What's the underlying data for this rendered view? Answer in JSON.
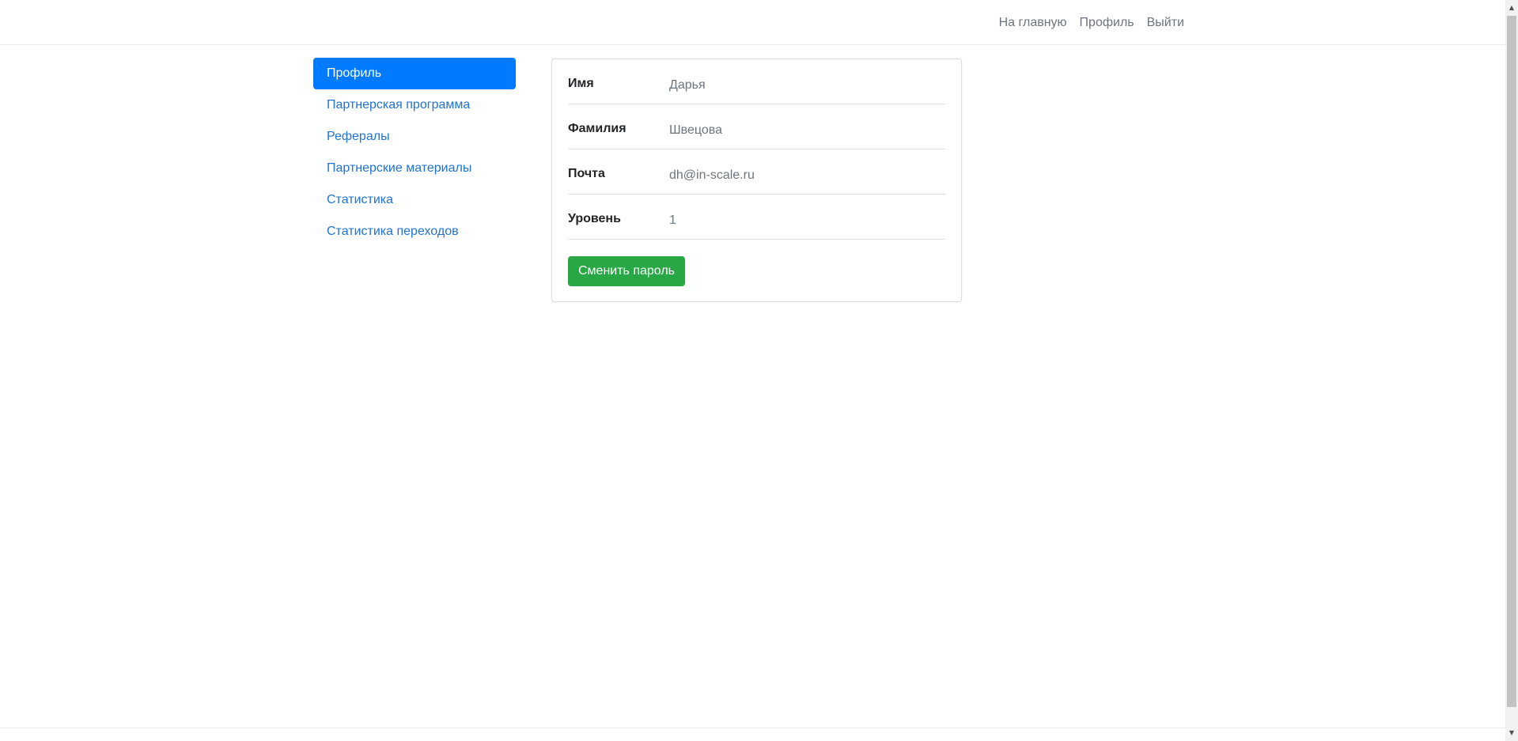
{
  "navbar": {
    "links": [
      "На главную",
      "Профиль",
      "Выйти"
    ]
  },
  "sidebar": {
    "items": [
      {
        "label": "Профиль",
        "active": true
      },
      {
        "label": "Партнерская программа",
        "active": false
      },
      {
        "label": "Рефералы",
        "active": false
      },
      {
        "label": "Партнерские материалы",
        "active": false
      },
      {
        "label": "Статистика",
        "active": false
      },
      {
        "label": "Статистика переходов",
        "active": false
      }
    ]
  },
  "profile": {
    "fields": [
      {
        "label": "Имя",
        "value": "Дарья"
      },
      {
        "label": "Фамилия",
        "value": "Швецова"
      },
      {
        "label": "Почта",
        "value": "dh@in-scale.ru"
      },
      {
        "label": "Уровень",
        "value": "1"
      }
    ],
    "change_password_label": "Сменить пароль"
  },
  "colors": {
    "primary": "#007bff",
    "link": "#1f73d2",
    "success": "#28a745",
    "muted": "#6c757d"
  },
  "icons": {
    "scroll_up": "scroll-up-arrow-icon",
    "scroll_down": "scroll-down-arrow-icon"
  }
}
